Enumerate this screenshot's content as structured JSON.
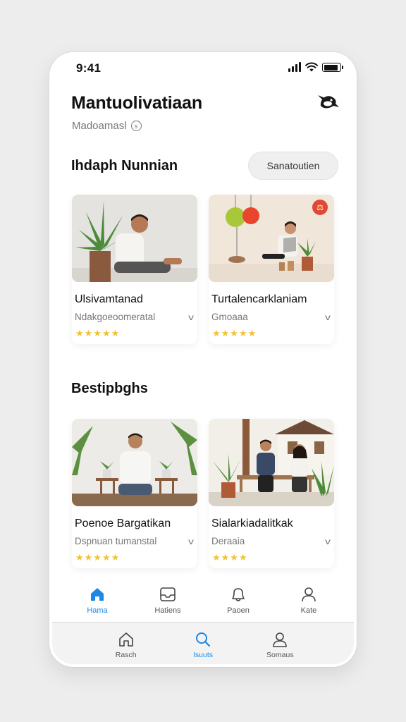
{
  "status": {
    "time": "9:41",
    "battery_level": 0.9
  },
  "header": {
    "title": "Mantuolivatiaan",
    "subtitle": "Madoamasl",
    "profile_icon": "bird-icon"
  },
  "section1": {
    "title": "Ihdaph Nunnian",
    "action_label": "Sanatoutien",
    "cards": [
      {
        "title": "Ulsivamtanad",
        "subtitle": "Ndakgoeoomeratal",
        "stars": "★★★★★",
        "rating": 5
      },
      {
        "title": "Turtalencarklaniam",
        "subtitle": "Gmoaaa",
        "stars": "★★★★★",
        "rating": 5
      }
    ]
  },
  "section2": {
    "title": "Bestipbghs",
    "cards": [
      {
        "title": "Poenoe Bargatikan",
        "subtitle": "Dspnuan tumanstal",
        "stars": "★★★★★",
        "rating": 5
      },
      {
        "title": "Sialarkiadalitkak",
        "subtitle": "Deraaia",
        "stars": "★★★★",
        "rating": 4
      }
    ]
  },
  "tabbar": {
    "items": [
      {
        "label": "Hama",
        "icon": "home-icon",
        "active": true
      },
      {
        "label": "Hatiens",
        "icon": "inbox-icon",
        "active": false
      },
      {
        "label": "Paoen",
        "icon": "bell-icon",
        "active": false
      },
      {
        "label": "Kate",
        "icon": "profile-icon",
        "active": false
      }
    ]
  },
  "bottombar": {
    "items": [
      {
        "label": "Rasch",
        "icon": "home-outline-icon",
        "active": false
      },
      {
        "label": "Isuuts",
        "icon": "search-icon",
        "active": true
      },
      {
        "label": "Somaus",
        "icon": "user-icon",
        "active": false
      }
    ]
  },
  "colors": {
    "accent": "#1e88e5",
    "star": "#f2c230",
    "background": "#ededee"
  }
}
